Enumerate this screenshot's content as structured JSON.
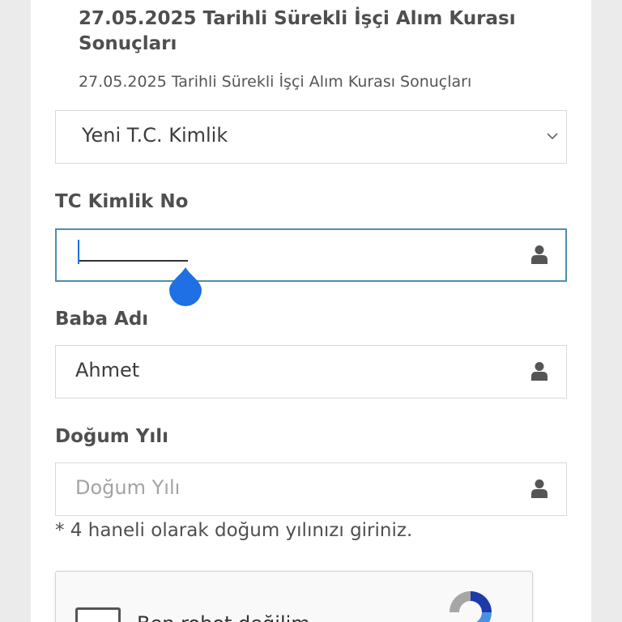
{
  "page": {
    "title": "27.05.2025 Tarihli Sürekli İşçi Alım Kurası Sonuçları",
    "subtitle": "27.05.2025 Tarihli Sürekli İşçi Alım Kurası Sonuçları"
  },
  "form": {
    "id_type_select": {
      "value": "Yeni T.C. Kimlik"
    },
    "tc_field": {
      "label": "TC Kimlik No",
      "value": ""
    },
    "father_field": {
      "label": "Baba Adı",
      "value": "Ahmet"
    },
    "birth_field": {
      "label": "Doğum Yılı",
      "placeholder": "Doğum Yılı",
      "value": "",
      "hint": "* 4 haneli olarak doğum yılınızı giriniz."
    }
  },
  "captcha": {
    "label": "Ben robot değilim"
  },
  "colors": {
    "focus_border": "#4a8fb0",
    "cursor_handle": "#1f6fe5"
  },
  "icons": {
    "field_icon": "user-icon",
    "select_icon": "chevron-down-icon",
    "captcha_icon": "recaptcha-icon"
  }
}
